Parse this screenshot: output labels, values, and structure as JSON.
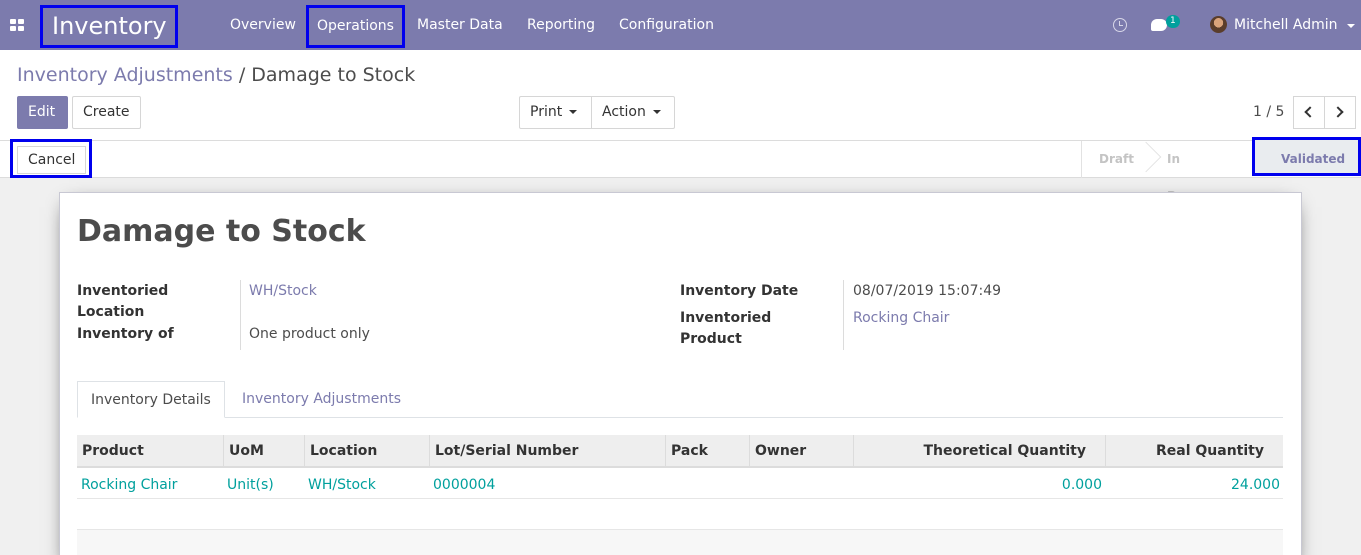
{
  "nav": {
    "brand": "Inventory",
    "menu": [
      "Overview",
      "Operations",
      "Master Data",
      "Reporting",
      "Configuration"
    ],
    "chat_count": "1",
    "user": "Mitchell Admin"
  },
  "breadcrumb": {
    "parent": "Inventory Adjustments",
    "separator": "/",
    "current": "Damage to Stock"
  },
  "buttons": {
    "edit": "Edit",
    "create": "Create",
    "print": "Print",
    "action": "Action",
    "cancel": "Cancel"
  },
  "pager": {
    "value": "1 / 5"
  },
  "stages": {
    "draft": "Draft",
    "in_progress": "In Progress",
    "validated": "Validated",
    "current": "Validated"
  },
  "record": {
    "title": "Damage to Stock",
    "inventoried_location_label": "Inventoried Location",
    "inventoried_location": "WH/Stock",
    "inventory_of_label": "Inventory of",
    "inventory_of": "One product only",
    "inventory_date_label": "Inventory Date",
    "inventory_date": "08/07/2019 15:07:49",
    "inventoried_product_label": "Inventoried Product",
    "inventoried_product": "Rocking Chair"
  },
  "tabs": [
    "Inventory Details",
    "Inventory Adjustments"
  ],
  "table": {
    "columns": [
      "Product",
      "UoM",
      "Location",
      "Lot/Serial Number",
      "Pack",
      "Owner",
      "Theoretical Quantity",
      "Real Quantity"
    ],
    "rows": [
      {
        "product": "Rocking Chair",
        "uom": "Unit(s)",
        "location": "WH/Stock",
        "lot": "0000004",
        "pack": "",
        "owner": "",
        "theoretical": "0.000",
        "real": "24.000"
      }
    ]
  },
  "colors": {
    "brand": "#7c7bad",
    "accent": "#00a09d",
    "highlight_border": "#0000ee"
  }
}
